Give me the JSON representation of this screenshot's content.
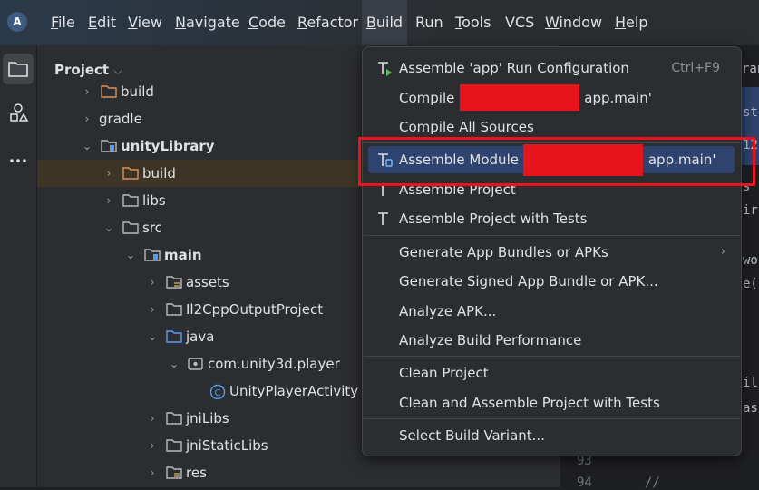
{
  "menubar": {
    "items": [
      {
        "label": "File",
        "u": "F",
        "rest": "ile"
      },
      {
        "label": "Edit",
        "u": "E",
        "rest": "dit"
      },
      {
        "label": "View",
        "u": "V",
        "rest": "iew"
      },
      {
        "label": "Navigate",
        "u": "N",
        "rest": "avigate"
      },
      {
        "label": "Code",
        "u": "C",
        "rest": "ode"
      },
      {
        "label": "Refactor",
        "u": "R",
        "rest": "efactor"
      },
      {
        "label": "Build",
        "u": "B",
        "rest": "uild"
      },
      {
        "label": "Run",
        "u": "",
        "rest": "Run"
      },
      {
        "label": "Tools",
        "u": "T",
        "rest": "ools"
      },
      {
        "label": "VCS",
        "u": "",
        "rest": "VCS"
      },
      {
        "label": "Window",
        "u": "W",
        "rest": "indow"
      },
      {
        "label": "Help",
        "u": "H",
        "rest": "elp"
      }
    ]
  },
  "project_panel": {
    "title": "Project",
    "tree": [
      {
        "label": "build",
        "kind": "folder-orange",
        "bold": false
      },
      {
        "label": "gradle",
        "kind": "none",
        "bold": false
      },
      {
        "label": "unityLibrary",
        "kind": "module",
        "bold": true
      },
      {
        "label": "build",
        "kind": "folder-orange",
        "bold": false
      },
      {
        "label": "libs",
        "kind": "folder",
        "bold": false
      },
      {
        "label": "src",
        "kind": "folder",
        "bold": false
      },
      {
        "label": "main",
        "kind": "module",
        "bold": true
      },
      {
        "label": "assets",
        "kind": "folder-res",
        "bold": false
      },
      {
        "label": "Il2CppOutputProject",
        "kind": "folder",
        "bold": false
      },
      {
        "label": "java",
        "kind": "folder-blue",
        "bold": false
      },
      {
        "label": "com.unity3d.player",
        "kind": "package",
        "bold": false
      },
      {
        "label": "UnityPlayerActivity",
        "kind": "class",
        "bold": false
      },
      {
        "label": "jniLibs",
        "kind": "folder",
        "bold": false
      },
      {
        "label": "jniStaticLibs",
        "kind": "folder",
        "bold": false
      },
      {
        "label": "res",
        "kind": "folder-res",
        "bold": false
      }
    ]
  },
  "editor": {
    "line_numbers": [
      "93",
      "94"
    ],
    "fragments": [
      "ran",
      "stru",
      "12",
      "s",
      "ir",
      "wo",
      "e(",
      "il",
      "as",
      "//"
    ]
  },
  "build_menu": {
    "items": [
      {
        "label": "Assemble 'app' Run Configuration",
        "shortcut": "Ctrl+F9",
        "icon": "hammer-run-icon"
      },
      {
        "label": "Compile '",
        "suffix": "app.main'",
        "icon": ""
      },
      {
        "label": "Compile All Sources",
        "icon": ""
      },
      {
        "label": "Assemble Module '",
        "suffix": "app.main'",
        "icon": "hammer-module-icon"
      },
      {
        "label": "Assemble Project",
        "icon": "hammer-icon"
      },
      {
        "label": "Assemble Project with Tests",
        "icon": "hammer-icon"
      },
      {
        "label": "Generate App Bundles or APKs",
        "icon": "",
        "submenu": "›"
      },
      {
        "label": "Generate Signed App Bundle or APK...",
        "icon": ""
      },
      {
        "label": "Analyze APK...",
        "icon": ""
      },
      {
        "label": "Analyze Build Performance",
        "icon": ""
      },
      {
        "label": "Clean Project",
        "icon": ""
      },
      {
        "label": "Clean and Assemble Project with Tests",
        "icon": ""
      },
      {
        "label": "Select Build Variant...",
        "icon": ""
      }
    ]
  },
  "colors": {
    "accent": "#2e436e",
    "redaction": "#e8141c",
    "highlight_row": "#3d3425"
  }
}
